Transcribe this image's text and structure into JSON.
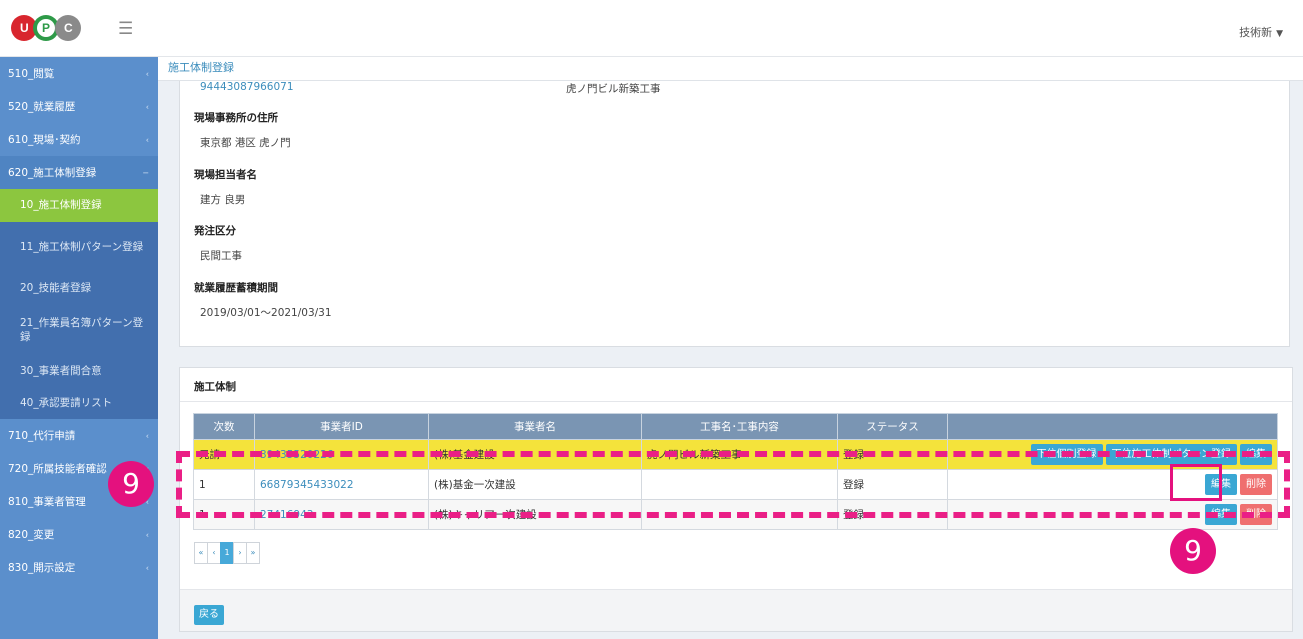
{
  "header": {
    "user_name": "技術新",
    "menu_icon": "hamburger-icon",
    "logo_text": [
      "U",
      "P",
      "C"
    ]
  },
  "sidebar": {
    "items": [
      {
        "label": "510_閲覧"
      },
      {
        "label": "520_就業履歴"
      },
      {
        "label": "610_現場･契約"
      },
      {
        "label": "620_施工体制登録"
      },
      {
        "label": "10_施工体制登録"
      },
      {
        "label": "11_施工体制パターン登録"
      },
      {
        "label": "20_技能者登録"
      },
      {
        "label": "21_作業員名簿パターン登録"
      },
      {
        "label": "30_事業者間合意"
      },
      {
        "label": "40_承認要請リスト"
      },
      {
        "label": "710_代行申請"
      },
      {
        "label": "720_所属技能者確認"
      },
      {
        "label": "810_事業者管理"
      },
      {
        "label": "820_変更"
      },
      {
        "label": "830_開示設定"
      }
    ]
  },
  "breadcrumb": "施工体制登録",
  "site_info": {
    "id_partial": "94443087966071",
    "name_partial": "虎ノ門ビル新築工事",
    "address_label": "現場事務所の住所",
    "address_value": "東京都 港区 虎ノ門",
    "manager_label": "現場担当者名",
    "manager_value": "建方 良男",
    "order_label": "発注区分",
    "order_value": "民間工事",
    "period_label": "就業履歴蓄積期間",
    "period_value": "2019/03/01～2021/03/31"
  },
  "structure": {
    "title": "施工体制",
    "columns": [
      "次数",
      "事業者ID",
      "事業者名",
      "工事名･工事内容",
      "ステータス",
      ""
    ],
    "rows": [
      {
        "tier": "元請",
        "id": "39435520226",
        "name": "(株)基金建設",
        "work": "虎ノ門ビル新築工事",
        "status": "登録",
        "buttons": [
          "下位個別登録",
          "下位施工体制パターン登録",
          "編集"
        ]
      },
      {
        "tier": "1",
        "id": "66879345433022",
        "name": "(株)基金一次建設",
        "work": "",
        "status": "登録",
        "buttons": [
          "編集",
          "削除"
        ]
      },
      {
        "tier": "1",
        "id": "27416943",
        "name": "(株)キャリア一次建設",
        "work": "",
        "status": "登録",
        "buttons": [
          "編集",
          "削除"
        ]
      }
    ],
    "pager": [
      "«",
      "‹",
      "1",
      "›",
      "»"
    ],
    "back_button": "戻る"
  },
  "annotations": {
    "step_left": "9",
    "step_right": "9"
  },
  "colors": {
    "sidebar": "#5b8fcc",
    "active_item": "#8cc63f",
    "highlight_row": "#f4e33b",
    "annotation": "#e4117e",
    "button": "#3aa7d4",
    "delete": "#ef6f6f"
  }
}
